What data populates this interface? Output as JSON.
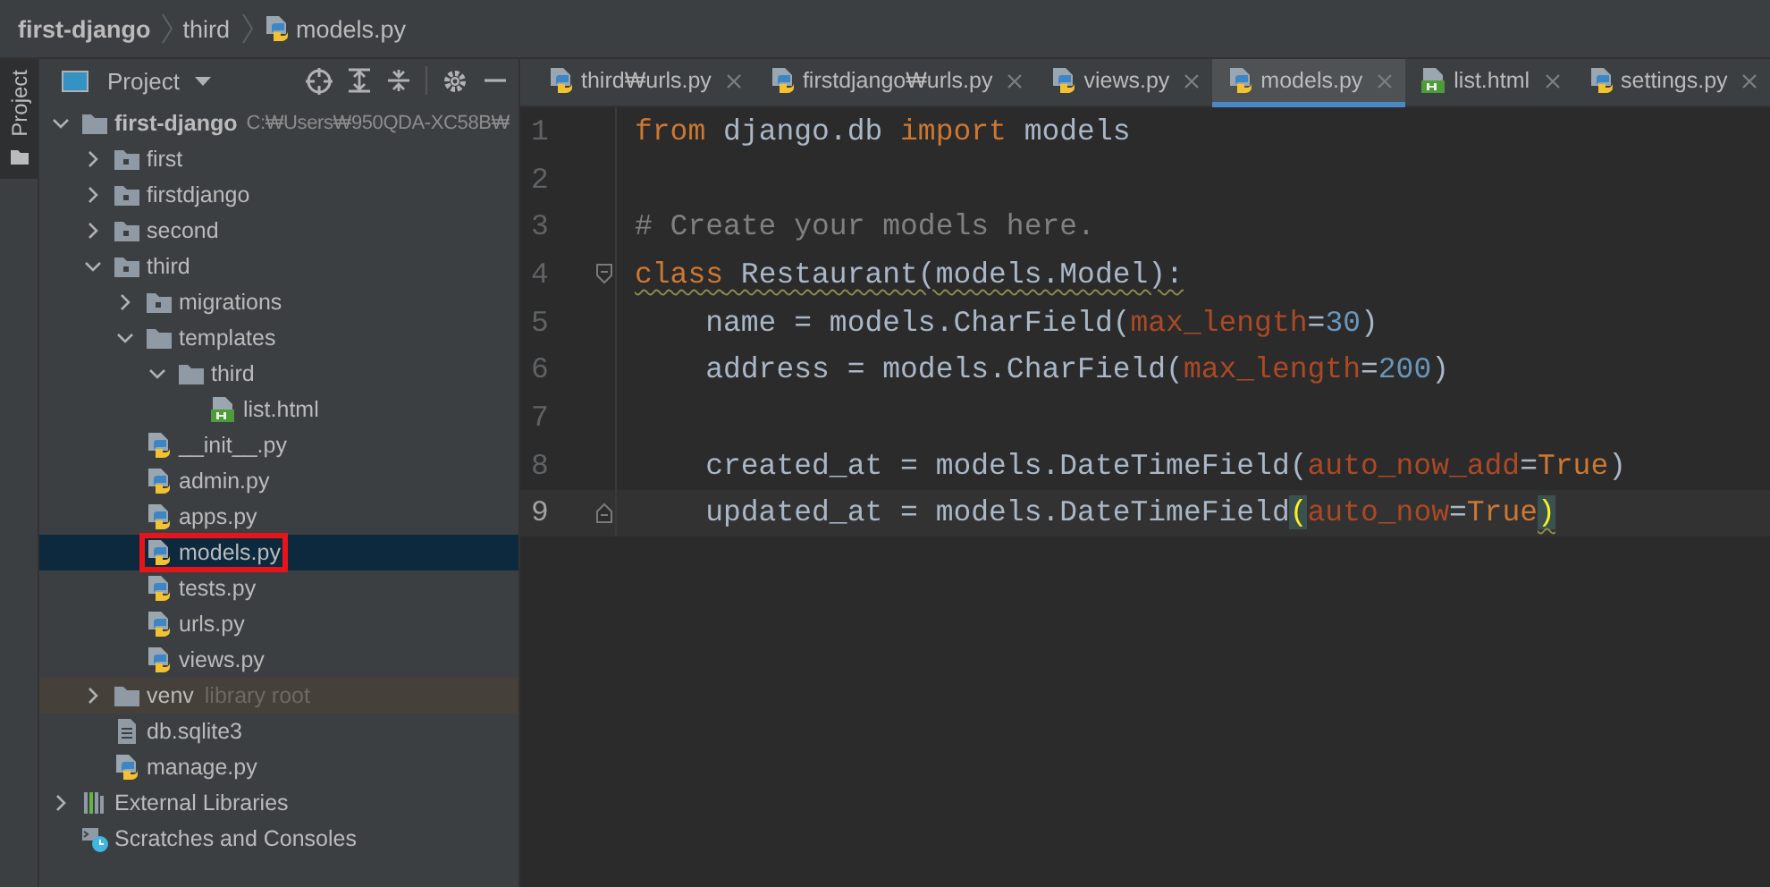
{
  "breadcrumbs": [
    {
      "label": "first-django",
      "kind": "directory"
    },
    {
      "label": "third",
      "kind": "directory"
    },
    {
      "label": "models.py",
      "kind": "python"
    }
  ],
  "tool_stripe": [
    {
      "label": "Project",
      "selected": true
    }
  ],
  "project_panel": {
    "title": "Project",
    "tree": [
      {
        "label": "first-django",
        "kind": "project_folder",
        "path": "C:₩Users₩950QDA-XC58B₩",
        "expanded": true,
        "selected": false,
        "annotated": false,
        "children": [
          {
            "label": "first",
            "kind": "module_folder",
            "expanded": false,
            "selected": false,
            "annotated": false
          },
          {
            "label": "firstdjango",
            "kind": "module_folder",
            "expanded": false,
            "selected": false,
            "annotated": false
          },
          {
            "label": "second",
            "kind": "module_folder",
            "expanded": false,
            "selected": false,
            "annotated": false
          },
          {
            "label": "third",
            "kind": "module_folder",
            "expanded": true,
            "selected": false,
            "annotated": false,
            "children": [
              {
                "label": "migrations",
                "kind": "module_folder",
                "expanded": false,
                "selected": false,
                "annotated": false
              },
              {
                "label": "templates",
                "kind": "folder",
                "expanded": true,
                "selected": false,
                "annotated": false,
                "children": [
                  {
                    "label": "third",
                    "kind": "folder",
                    "expanded": true,
                    "selected": false,
                    "annotated": false,
                    "children": [
                      {
                        "label": "list.html",
                        "kind": "html",
                        "selected": false,
                        "annotated": false
                      }
                    ]
                  }
                ]
              },
              {
                "label": "__init__.py",
                "kind": "python",
                "selected": false,
                "annotated": false
              },
              {
                "label": "admin.py",
                "kind": "python",
                "selected": false,
                "annotated": false
              },
              {
                "label": "apps.py",
                "kind": "python",
                "selected": false,
                "annotated": false
              },
              {
                "label": "models.py",
                "kind": "python",
                "selected": true,
                "annotated": true
              },
              {
                "label": "tests.py",
                "kind": "python",
                "selected": false,
                "annotated": false
              },
              {
                "label": "urls.py",
                "kind": "python",
                "selected": false,
                "annotated": false
              },
              {
                "label": "views.py",
                "kind": "python",
                "selected": false,
                "annotated": false
              }
            ]
          },
          {
            "label": "venv",
            "kind": "library_folder",
            "note": "library root",
            "expanded": false,
            "selected": false,
            "annotated": false
          },
          {
            "label": "db.sqlite3",
            "kind": "text",
            "selected": false,
            "annotated": false
          },
          {
            "label": "manage.py",
            "kind": "python",
            "selected": false,
            "annotated": false
          }
        ]
      },
      {
        "label": "External Libraries",
        "kind": "libraries",
        "expanded": false,
        "selected": false,
        "annotated": false
      },
      {
        "label": "Scratches and Consoles",
        "kind": "scratches",
        "selected": false,
        "annotated": false
      }
    ]
  },
  "tabs": [
    {
      "label": "third₩urls.py",
      "kind": "python",
      "selected": false
    },
    {
      "label": "firstdjango₩urls.py",
      "kind": "python",
      "selected": false
    },
    {
      "label": "views.py",
      "kind": "python",
      "selected": false
    },
    {
      "label": "models.py",
      "kind": "python",
      "selected": true
    },
    {
      "label": "list.html",
      "kind": "html",
      "selected": false
    },
    {
      "label": "settings.py",
      "kind": "python",
      "selected": false
    }
  ],
  "editor": {
    "lines": [
      {
        "number": "1",
        "current": false,
        "tokens": [
          {
            "text": "from",
            "kind": "keyword"
          },
          {
            "text": " django.db ",
            "kind": "plain"
          },
          {
            "text": "import",
            "kind": "keyword"
          },
          {
            "text": " models",
            "kind": "plain"
          }
        ]
      },
      {
        "number": "2",
        "current": false
      },
      {
        "number": "3",
        "current": false,
        "tokens": [
          {
            "text": "# Create your models here.",
            "kind": "comment"
          }
        ]
      },
      {
        "number": "4",
        "current": false,
        "fold_start": true,
        "tokens": [
          {
            "text": "class",
            "kind": "keyword",
            "warning": true
          },
          {
            "text": " Restaurant(models.Model):",
            "kind": "plain",
            "warning": true
          }
        ]
      },
      {
        "number": "5",
        "current": false,
        "tokens": [
          {
            "text": "    name = models.CharField(",
            "kind": "plain"
          },
          {
            "text": "max_length",
            "kind": "param"
          },
          {
            "text": "=",
            "kind": "plain"
          },
          {
            "text": "30",
            "kind": "number"
          },
          {
            "text": ")",
            "kind": "plain"
          }
        ]
      },
      {
        "number": "6",
        "current": false,
        "tokens": [
          {
            "text": "    address = models.CharField(",
            "kind": "plain"
          },
          {
            "text": "max_length",
            "kind": "param"
          },
          {
            "text": "=",
            "kind": "plain"
          },
          {
            "text": "200",
            "kind": "number"
          },
          {
            "text": ")",
            "kind": "plain"
          }
        ]
      },
      {
        "number": "7",
        "current": false
      },
      {
        "number": "8",
        "current": false,
        "tokens": [
          {
            "text": "    created_at = models.DateTimeField(",
            "kind": "plain"
          },
          {
            "text": "auto_now_add",
            "kind": "param"
          },
          {
            "text": "=",
            "kind": "plain"
          },
          {
            "text": "True",
            "kind": "keyword"
          },
          {
            "text": ")",
            "kind": "plain"
          }
        ]
      },
      {
        "number": "9",
        "current": true,
        "fold_end": true,
        "tokens": [
          {
            "text": "    updated_at = models.DateTimeField",
            "kind": "plain"
          },
          {
            "text": "(",
            "kind": "paren_match"
          },
          {
            "text": "auto_now",
            "kind": "param"
          },
          {
            "text": "=",
            "kind": "plain"
          },
          {
            "text": "True",
            "kind": "keyword"
          },
          {
            "text": ")",
            "kind": "paren_match",
            "warning": true
          }
        ]
      }
    ]
  }
}
